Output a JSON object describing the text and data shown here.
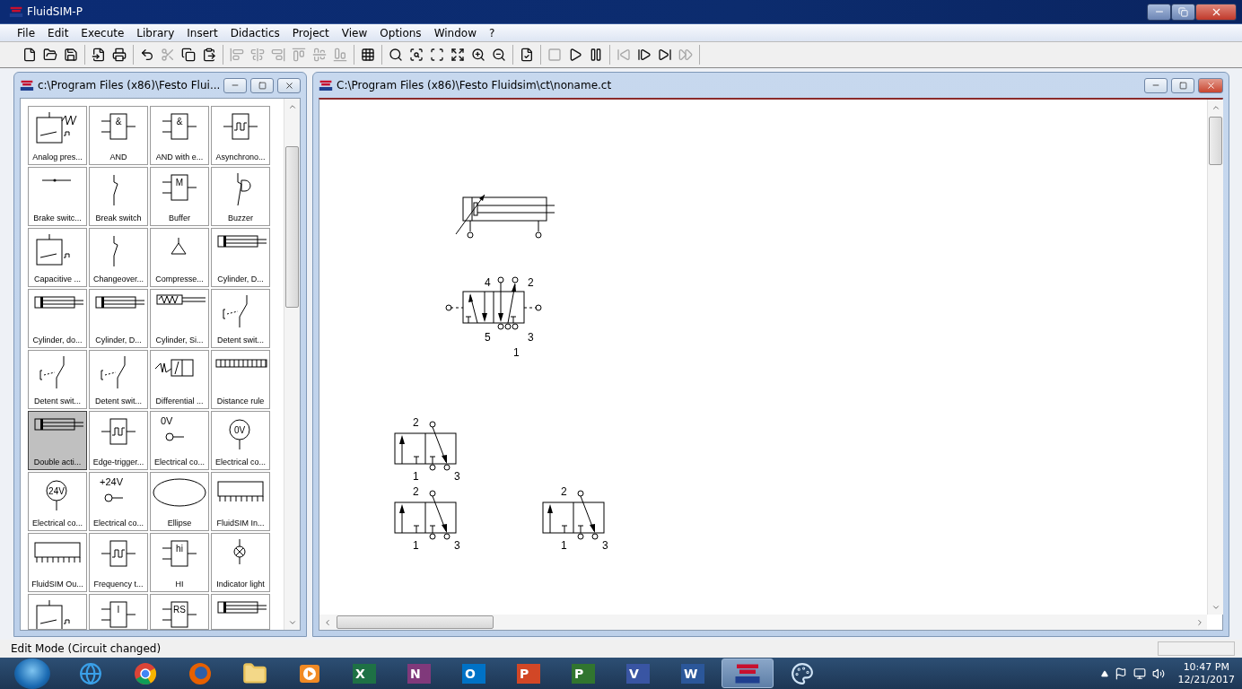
{
  "window": {
    "title": "FluidSIM-P"
  },
  "menu": [
    "File",
    "Edit",
    "Execute",
    "Library",
    "Insert",
    "Didactics",
    "Project",
    "View",
    "Options",
    "Window",
    "?"
  ],
  "toolbar": [
    [
      {
        "kind": "new",
        "disabled": false
      },
      {
        "kind": "open",
        "disabled": false
      },
      {
        "kind": "save",
        "disabled": false
      }
    ],
    [
      {
        "kind": "import",
        "disabled": false
      },
      {
        "kind": "print",
        "disabled": false
      }
    ],
    [
      {
        "kind": "undo",
        "disabled": false
      },
      {
        "kind": "cut",
        "disabled": true
      },
      {
        "kind": "copy",
        "disabled": false
      },
      {
        "kind": "paste",
        "disabled": false
      }
    ],
    [
      {
        "kind": "align-left",
        "disabled": true
      },
      {
        "kind": "align-center",
        "disabled": true
      },
      {
        "kind": "align-right",
        "disabled": true
      },
      {
        "kind": "align-top",
        "disabled": true
      },
      {
        "kind": "align-middle",
        "disabled": true
      },
      {
        "kind": "align-bottom",
        "disabled": true
      }
    ],
    [
      {
        "kind": "grid",
        "disabled": false
      }
    ],
    [
      {
        "kind": "zoom-actual",
        "disabled": false
      },
      {
        "kind": "zoom-fit",
        "disabled": false
      },
      {
        "kind": "zoom-window",
        "disabled": false
      },
      {
        "kind": "zoom-previous",
        "disabled": false
      },
      {
        "kind": "zoom-in",
        "disabled": false
      },
      {
        "kind": "zoom-out",
        "disabled": false
      }
    ],
    [
      {
        "kind": "check",
        "disabled": false
      }
    ],
    [
      {
        "kind": "stop",
        "disabled": true
      },
      {
        "kind": "play",
        "disabled": false
      },
      {
        "kind": "pause",
        "disabled": false
      }
    ],
    [
      {
        "kind": "reset",
        "disabled": true
      },
      {
        "kind": "step",
        "disabled": false
      },
      {
        "kind": "step-to",
        "disabled": false
      },
      {
        "kind": "last",
        "disabled": true
      }
    ]
  ],
  "library": {
    "title": "c:\\Program Files (x86)\\Festo Flui...",
    "tiles": [
      {
        "label": "Analog pres...",
        "kind": "analog",
        "selected": false
      },
      {
        "label": "AND",
        "kind": "gate",
        "symbol_text": "&",
        "selected": false
      },
      {
        "label": "AND with e...",
        "kind": "gate",
        "symbol_text": "&",
        "selected": false
      },
      {
        "label": "Asynchrono...",
        "kind": "pulse",
        "selected": false
      },
      {
        "label": "Brake switc...",
        "kind": "brake",
        "selected": false
      },
      {
        "label": "Break switch",
        "kind": "switch",
        "selected": false
      },
      {
        "label": "Buffer",
        "kind": "gate",
        "symbol_text": "M",
        "selected": false
      },
      {
        "label": "Buzzer",
        "kind": "buzzer",
        "selected": false
      },
      {
        "label": "Capacitive ...",
        "kind": "sensor",
        "selected": false
      },
      {
        "label": "Changeover...",
        "kind": "switch",
        "selected": false
      },
      {
        "label": "Compresse...",
        "kind": "triangle",
        "selected": false
      },
      {
        "label": "Cylinder, D...",
        "kind": "cylinder",
        "selected": false
      },
      {
        "label": "Cylinder, do...",
        "kind": "cylinder",
        "selected": false
      },
      {
        "label": "Cylinder, D...",
        "kind": "cylinder",
        "selected": false
      },
      {
        "label": "Cylinder, Si...",
        "kind": "spring-cylinder",
        "selected": false
      },
      {
        "label": "Detent swit...",
        "kind": "detent",
        "selected": false
      },
      {
        "label": "Detent swit...",
        "kind": "detent",
        "selected": false
      },
      {
        "label": "Detent swit...",
        "kind": "detent",
        "selected": false
      },
      {
        "label": "Differential ...",
        "kind": "valve",
        "selected": false
      },
      {
        "label": "Distance rule",
        "kind": "ruler",
        "selected": false
      },
      {
        "label": "Double acti...",
        "kind": "cylinder",
        "selected": true
      },
      {
        "label": "Edge-trigger...",
        "kind": "pulse",
        "selected": false
      },
      {
        "label": "Electrical co...",
        "kind": "terminal",
        "symbol_text": "0V",
        "selected": false
      },
      {
        "label": "Electrical co...",
        "kind": "circle",
        "symbol_text": "0V",
        "selected": false
      },
      {
        "label": "Electrical co...",
        "kind": "circle",
        "symbol_text": "24V",
        "selected": false
      },
      {
        "label": "Electrical co...",
        "kind": "terminal",
        "symbol_text": "+24V",
        "selected": false
      },
      {
        "label": "Ellipse",
        "kind": "ellipse",
        "selected": false
      },
      {
        "label": "FluidSIM In...",
        "kind": "module",
        "selected": false
      },
      {
        "label": "FluidSIM Ou...",
        "kind": "module",
        "selected": false
      },
      {
        "label": "Frequency t...",
        "kind": "pulse",
        "selected": false
      },
      {
        "label": "HI",
        "kind": "gate",
        "symbol_text": "hi",
        "selected": false
      },
      {
        "label": "Indicator light",
        "kind": "lamp",
        "selected": false
      },
      {
        "kind": "sensor",
        "selected": false
      },
      {
        "kind": "gate",
        "symbol_text": "I",
        "selected": false
      },
      {
        "kind": "gate",
        "symbol_text": "RS",
        "selected": false
      },
      {
        "kind": "cylinder",
        "selected": false
      }
    ]
  },
  "circuit": {
    "title": "C:\\Program Files (x86)\\Festo Fluidsim\\ct\\noname.ct",
    "components": [
      {
        "kind": "cylinder"
      },
      {
        "kind": "valve-5-2",
        "ports": [
          "4",
          "2",
          "5",
          "3",
          "1"
        ]
      },
      {
        "kind": "valve-3-2",
        "ports": [
          "2",
          "1",
          "3"
        ]
      },
      {
        "kind": "valve-3-2",
        "ports": [
          "2",
          "1",
          "3"
        ]
      },
      {
        "kind": "valve-3-2",
        "ports": [
          "2",
          "1",
          "3"
        ]
      }
    ]
  },
  "status_bar": {
    "text": "Edit Mode (Circuit changed)"
  },
  "taskbar": {
    "apps": [
      {
        "kind": "ie",
        "selected": false
      },
      {
        "kind": "chrome",
        "selected": false
      },
      {
        "kind": "firefox",
        "selected": false
      },
      {
        "kind": "folder",
        "selected": false
      },
      {
        "kind": "media",
        "selected": false
      },
      {
        "kind": "office",
        "letter": "X",
        "color": "#1e7145",
        "selected": false
      },
      {
        "kind": "office",
        "letter": "N",
        "color": "#80397b",
        "selected": false
      },
      {
        "kind": "office",
        "letter": "O",
        "color": "#0072c6",
        "selected": false
      },
      {
        "kind": "office",
        "letter": "P",
        "color": "#d24726",
        "selected": false
      },
      {
        "kind": "office",
        "letter": "P",
        "color": "#31752f",
        "selected": false
      },
      {
        "kind": "office",
        "letter": "V",
        "color": "#3955a3",
        "selected": false
      },
      {
        "kind": "office",
        "letter": "W",
        "color": "#2b579a",
        "selected": false
      },
      {
        "kind": "festo",
        "selected": true
      },
      {
        "kind": "paint",
        "selected": false
      }
    ],
    "time": "10:47 PM",
    "date": "12/21/2017"
  }
}
